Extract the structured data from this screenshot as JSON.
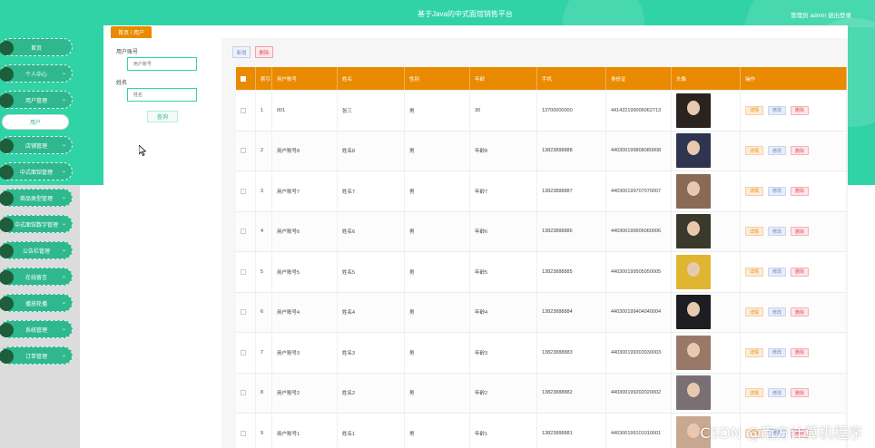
{
  "header": {
    "title": "基于Java的中式面馆销售平台",
    "admin_text": "管理员 admin  退出登录"
  },
  "breadcrumb": "首页 / 用户",
  "sidebar": {
    "items": [
      {
        "label": "首页",
        "has_chevron": false,
        "active": false
      },
      {
        "label": "个人中心",
        "has_chevron": true,
        "active": false
      },
      {
        "label": "用户管理",
        "has_chevron": true,
        "active": false
      },
      {
        "label": "用户",
        "has_chevron": false,
        "active": true
      },
      {
        "label": "店铺管理",
        "has_chevron": true,
        "active": false
      },
      {
        "label": "中式面馆管理",
        "has_chevron": true,
        "active": false
      },
      {
        "label": "商品类型管理",
        "has_chevron": true,
        "active": false
      },
      {
        "label": "中式面馆数字管理",
        "has_chevron": true,
        "active": false
      },
      {
        "label": "公告栏管理",
        "has_chevron": true,
        "active": false
      },
      {
        "label": "在线留言",
        "has_chevron": true,
        "active": false
      },
      {
        "label": "播放轮播",
        "has_chevron": true,
        "active": false
      },
      {
        "label": "系统管理",
        "has_chevron": true,
        "active": false
      },
      {
        "label": "订单管理",
        "has_chevron": true,
        "active": false
      }
    ]
  },
  "filters": {
    "account_label": "用户账号",
    "account_placeholder": "用户账号",
    "name_label": "姓名",
    "name_placeholder": "姓名",
    "query_button": "查询"
  },
  "toolbar": {
    "add_label": "新增",
    "delete_label": "删除"
  },
  "table": {
    "columns": [
      "",
      "索引",
      "用户账号",
      "姓名",
      "性别",
      "年龄",
      "手机",
      "身份证",
      "头像",
      "操作"
    ],
    "actions": {
      "detail": "详情",
      "edit": "修改",
      "delete": "删除"
    },
    "rows": [
      {
        "index": "1",
        "account": "001",
        "name": "张三",
        "gender": "男",
        "age": "30",
        "phone": "13700000000",
        "id_card": "441422199006062713",
        "avatar_color": "#2a2320"
      },
      {
        "index": "2",
        "account": "用户账号8",
        "name": "姓名8",
        "gender": "男",
        "age": "年龄8",
        "phone": "13823888888",
        "id_card": "440300199808080008",
        "avatar_color": "#2f3550"
      },
      {
        "index": "3",
        "account": "用户账号7",
        "name": "姓名7",
        "gender": "男",
        "age": "年龄7",
        "phone": "13823888887",
        "id_card": "440300199707070007",
        "avatar_color": "#8a6a55"
      },
      {
        "index": "4",
        "account": "用户账号6",
        "name": "姓名6",
        "gender": "男",
        "age": "年龄6",
        "phone": "13823888886",
        "id_card": "440300199606060006",
        "avatar_color": "#3a3a2c"
      },
      {
        "index": "5",
        "account": "用户账号5",
        "name": "姓名5",
        "gender": "男",
        "age": "年龄5",
        "phone": "13823888885",
        "id_card": "440300199505050005",
        "avatar_color": "#e0b530"
      },
      {
        "index": "6",
        "account": "用户账号4",
        "name": "姓名4",
        "gender": "男",
        "age": "年龄4",
        "phone": "13823888884",
        "id_card": "440300199404040004",
        "avatar_color": "#1e1e22"
      },
      {
        "index": "7",
        "account": "用户账号3",
        "name": "姓名3",
        "gender": "男",
        "age": "年龄3",
        "phone": "13823888883",
        "id_card": "440300199303030003",
        "avatar_color": "#9a7868"
      },
      {
        "index": "8",
        "account": "用户账号2",
        "name": "姓名2",
        "gender": "男",
        "age": "年龄2",
        "phone": "13823888882",
        "id_card": "440300199202020002",
        "avatar_color": "#7a6f72"
      },
      {
        "index": "9",
        "account": "用户账号1",
        "name": "姓名1",
        "gender": "男",
        "age": "年龄1",
        "phone": "13823888881",
        "id_card": "440300199101010001",
        "avatar_color": "#c9a891"
      }
    ]
  },
  "watermark": "CSDN @南方计算机程序",
  "colors": {
    "accent_teal": "#2fd3a6",
    "header_orange": "#e98a00"
  }
}
